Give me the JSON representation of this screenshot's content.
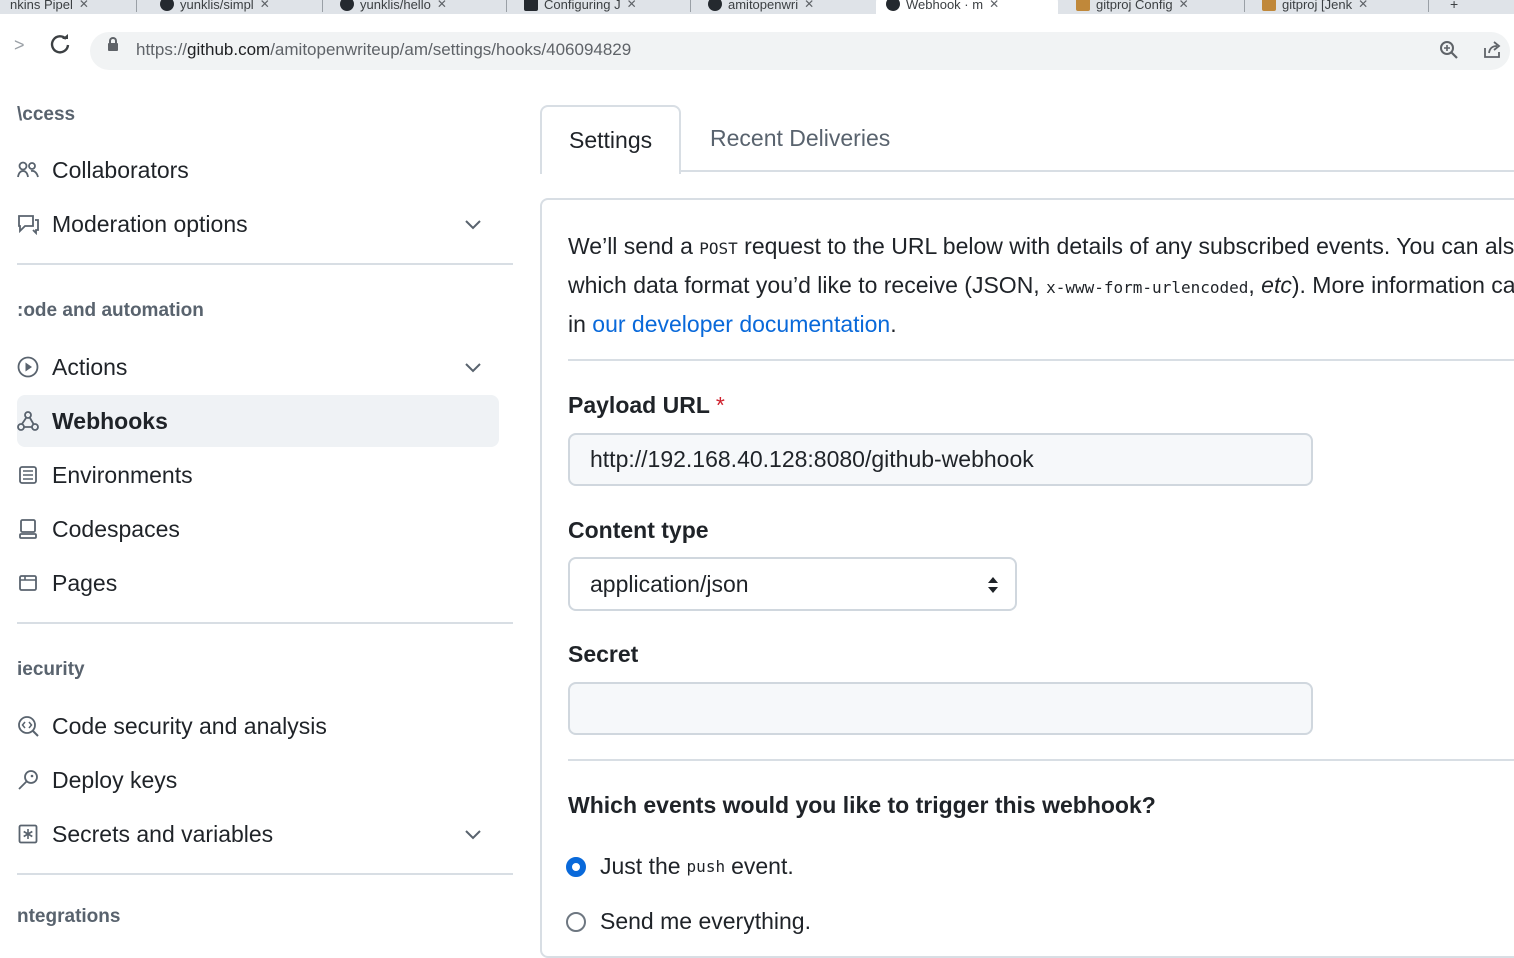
{
  "browser": {
    "tabs": [
      {
        "label": "nkins Pipel"
      },
      {
        "label": "yunklis/simpl"
      },
      {
        "label": "yunklis/hello"
      },
      {
        "label": "Configuring J"
      },
      {
        "label": "amitopenwri"
      },
      {
        "label": "Webhook · m"
      },
      {
        "label": "gitproj Config"
      },
      {
        "label": "gitproj [Jenk"
      }
    ],
    "url_prefix": "https://",
    "url_host": "github.com",
    "url_path": "/amitopenwriteup/am/settings/hooks/406094829"
  },
  "sidebar": {
    "sections": [
      {
        "heading": "\\ccess"
      },
      {
        "heading": ":ode and automation"
      },
      {
        "heading": "iecurity"
      },
      {
        "heading": "ntegrations"
      }
    ],
    "items": [
      {
        "label": "Collaborators",
        "icon": "people-icon"
      },
      {
        "label": "Moderation options",
        "icon": "report-icon",
        "expandable": true
      },
      {
        "label": "Actions",
        "icon": "play-icon",
        "expandable": true
      },
      {
        "label": "Webhooks",
        "icon": "webhook-icon",
        "active": true
      },
      {
        "label": "Environments",
        "icon": "server-icon"
      },
      {
        "label": "Codespaces",
        "icon": "codespaces-icon"
      },
      {
        "label": "Pages",
        "icon": "browser-icon"
      },
      {
        "label": "Code security and analysis",
        "icon": "codescan-icon"
      },
      {
        "label": "Deploy keys",
        "icon": "key-icon"
      },
      {
        "label": "Secrets and variables",
        "icon": "key-asterisk-icon",
        "expandable": true
      }
    ]
  },
  "main": {
    "tabs": [
      {
        "label": "Settings",
        "selected": true
      },
      {
        "label": "Recent Deliveries",
        "selected": false
      }
    ],
    "intro": {
      "line1_a": "We’ll send a ",
      "line1_code": "POST",
      "line1_b": " request to the URL below with details of any subscribed events. You can also specify",
      "line2_a": "which data format you’d like to receive (JSON, ",
      "line2_code": "x-www-form-urlencoded",
      "line2_b": ", ",
      "line2_em": "etc",
      "line2_c": "). More information can be found",
      "line3_a": "in ",
      "line3_link": "our developer documentation",
      "line3_b": "."
    },
    "payload_url": {
      "label": "Payload URL",
      "required_mark": "*",
      "value": "http://192.168.40.128:8080/github-webhook"
    },
    "content_type": {
      "label": "Content type",
      "value": "application/json"
    },
    "secret": {
      "label": "Secret",
      "value": ""
    },
    "events": {
      "question": "Which events would you like to trigger this webhook?",
      "option1_a": "Just the ",
      "option1_code": "push",
      "option1_b": " event.",
      "option2": "Send me everything."
    }
  },
  "colors": {
    "accent": "#0969da",
    "required": "#cf222e",
    "active_bg": "#eff2f5",
    "border": "#d0d7de"
  }
}
